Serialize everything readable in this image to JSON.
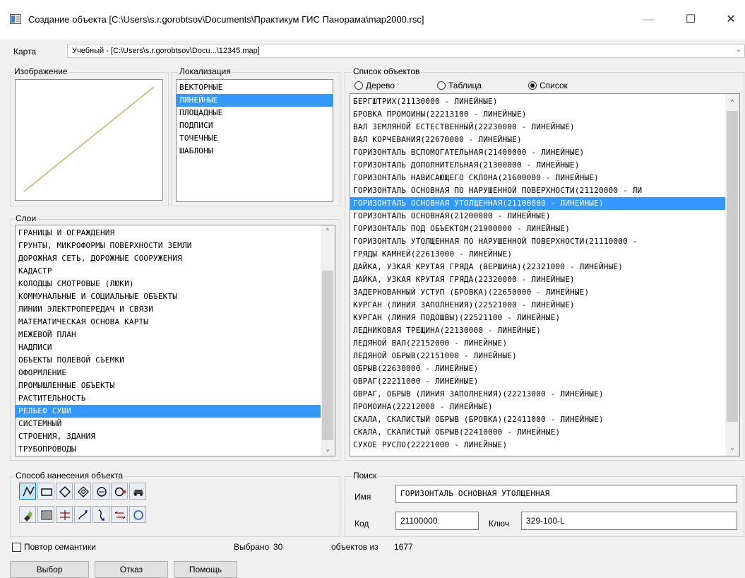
{
  "window": {
    "title": "Создание объекта  [C:\\Users\\s.r.gorobtsov\\Documents\\Практикум ГИС Панорама\\map2000.rsc]",
    "minimize_glyph": "—",
    "maximize_glyph": "☐",
    "close_glyph": "✕"
  },
  "map": {
    "label": "Карта",
    "selected": "Учебный - [C:\\Users\\s.r.gorobtsov\\Docu...\\12345.map]"
  },
  "image_panel": {
    "label": "Изображение",
    "line_color": "#c8b47a"
  },
  "localization": {
    "label": "Локализация",
    "items": [
      "ВЕКТОРНЫЕ",
      "ЛИНЕЙНЫЕ",
      "ПЛОЩАДНЫЕ",
      "ПОДПИСИ",
      "ТОЧЕЧНЫЕ",
      "ШАБЛОНЫ"
    ],
    "selected_index": 1
  },
  "layers": {
    "label": "Слои",
    "items": [
      "ГРАНИЦЫ И ОГРАЖДЕНИЯ",
      "ГРУНТЫ, МИКРОФОРМЫ ПОВЕРХНОСТИ ЗЕМЛИ",
      "ДОРОЖНАЯ СЕТЬ, ДОРОЖНЫЕ СООРУЖЕНИЯ",
      "КАДАСТР",
      "КОЛОДЦЫ СМОТРОВЫЕ (ЛЮКИ)",
      "КОММУНАЛЬНЫЕ И СОЦИАЛЬНЫЕ ОБЪЕКТЫ",
      "ЛИНИИ ЭЛЕКТРОПЕРЕДАЧ И СВЯЗИ",
      "МАТЕМАТИЧЕСКАЯ ОСНОВА КАРТЫ",
      "МЕЖЕВОЙ ПЛАН",
      "НАДПИСИ",
      "ОБЪЕКТЫ ПОЛЕВОЙ СЪЕМКИ",
      "ОФОРМЛЕНИЕ",
      "ПРОМЫШЛЕННЫЕ ОБЪЕКТЫ",
      "РАСТИТЕЛЬНОСТЬ",
      "РЕЛЬЕФ  СУШИ",
      "СИСТЕМНЫЙ",
      "СТРОЕНИЯ, ЗДАНИЯ",
      "ТРУБОПРОВОДЫ"
    ],
    "selected_index": 14
  },
  "objects": {
    "label": "Список объектов",
    "view_modes": [
      {
        "label": "Дерево",
        "checked": false
      },
      {
        "label": "Таблица",
        "checked": false
      },
      {
        "label": "Список",
        "checked": true
      }
    ],
    "items": [
      "БЕРГШТРИХ(21130000 - ЛИНЕЙНЫЕ)",
      "БРОВКА ПРОМОИНЫ(22213100 - ЛИНЕЙНЫЕ)",
      "ВАЛ ЗЕМЛЯНОЙ ЕСТЕСТВЕННЫЙ(22230000 - ЛИНЕЙНЫЕ)",
      "ВАЛ КОРЧЕВАНИЯ(22670000 - ЛИНЕЙНЫЕ)",
      "ГОРИЗОНТАЛЬ ВСПОМОГАТЕЛЬНАЯ(21400000 - ЛИНЕЙНЫЕ)",
      "ГОРИЗОНТАЛЬ ДОПОЛНИТЕЛЬНАЯ(21300000 - ЛИНЕЙНЫЕ)",
      "ГОРИЗОНТАЛЬ НАВИСАЮЩЕГО СКЛОНА(21600000 - ЛИНЕЙНЫЕ)",
      "ГОРИЗОНТАЛЬ ОСНОВНАЯ ПО НАРУШЕННОЙ ПОВЕРХНОСТИ(21120000 - ЛИ",
      "ГОРИЗОНТАЛЬ ОСНОВНАЯ УТОЛЩЕННАЯ(21100000 - ЛИНЕЙНЫЕ)",
      "ГОРИЗОНТАЛЬ ОСНОВНАЯ(21200000 - ЛИНЕЙНЫЕ)",
      "ГОРИЗОНТАЛЬ ПОД ОБЪЕКТОМ(21900000 - ЛИНЕЙНЫЕ)",
      "ГОРИЗОНТАЛЬ УТОЛЩЕННАЯ ПО НАРУШЕННОЙ ПОВЕРХНОСТИ(21110000 -",
      "ГРЯДЫ КАМНЕЙ(22613000 - ЛИНЕЙНЫЕ)",
      "ДАЙКА, УЗКАЯ КРУТАЯ ГРЯДА (ВЕРШИНА)(22321000 - ЛИНЕЙНЫЕ)",
      "ДАЙКА, УЗКАЯ КРУТАЯ ГРЯДА(22320000 - ЛИНЕЙНЫЕ)",
      "ЗАДЕРНОВАННЫЙ УСТУП (БРОВКА)(22650000 - ЛИНЕЙНЫЕ)",
      "КУРГАН (ЛИНИЯ ЗАПОЛНЕНИЯ)(22521000 - ЛИНЕЙНЫЕ)",
      "КУРГАН (ЛИНИЯ ПОДОШВЫ)(22521100 - ЛИНЕЙНЫЕ)",
      "ЛЕДНИКОВАЯ ТРЕЩИНА(22130000 - ЛИНЕЙНЫЕ)",
      "ЛЕДЯНОЙ ВАЛ(22152000 - ЛИНЕЙНЫЕ)",
      "ЛЕДЯНОЙ ОБРЫВ(22151000 - ЛИНЕЙНЫЕ)",
      "ОБРЫВ(22630000 - ЛИНЕЙНЫЕ)",
      "ОВРАГ(22211000 - ЛИНЕЙНЫЕ)",
      "ОВРАГ, ОБРЫВ (ЛИНИЯ ЗАПОЛНЕНИЯ)(22213000 - ЛИНЕЙНЫЕ)",
      "ПРОМОИНА(22212000 - ЛИНЕЙНЫЕ)",
      "СКАЛА, СКАЛИСТЫЙ ОБРЫВ (БРОВКА)(22411000 - ЛИНЕЙНЫЕ)",
      "СКАЛА, СКАЛИСТЫЙ ОБРЫВ(22410000 - ЛИНЕЙНЫЕ)",
      "СУХОЕ РУСЛО(22221000 - ЛИНЕЙНЫЕ)"
    ],
    "selected_index": 8
  },
  "draw_method": {
    "label": "Способ нанесения объекта",
    "tools": [
      "polyline-icon",
      "rectangle-icon",
      "rotated-square-icon",
      "double-diamond-icon",
      "circle-icon",
      "circle-arrow-icon",
      "vehicle-icon",
      "paint-icon",
      "hatch-icon",
      "parallel-lines-icon",
      "curve-arrow-icon",
      "double-curve-icon",
      "offset-lines-icon",
      "circle-outline-icon"
    ],
    "selected_index": 0
  },
  "search": {
    "label": "Поиск",
    "name_label": "Имя",
    "name_value": "ГОРИЗОНТАЛЬ ОСНОВНАЯ УТОЛЩЕННАЯ",
    "code_label": "Код",
    "code_value": "21100000",
    "key_label": "Ключ",
    "key_value": "329-100-L"
  },
  "footer": {
    "repeat_semantics": "Повтор семантики",
    "selected_label": "Выбрано",
    "selected_count": "30",
    "of_label": "объектов из",
    "total_count": "1677",
    "buttons": [
      "Выбор",
      "Отказ",
      "Помощь"
    ]
  }
}
